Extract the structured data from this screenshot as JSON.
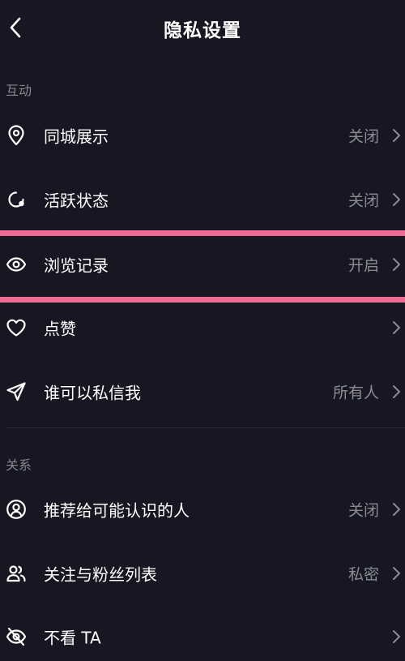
{
  "header": {
    "title": "隐私设置",
    "back_icon": "chevron-left-icon"
  },
  "sections": {
    "interaction": {
      "title": "互动",
      "items": [
        {
          "label": "同城展示",
          "value": "关闭",
          "icon": "location-pin-icon"
        },
        {
          "label": "活跃状态",
          "value": "关闭",
          "icon": "activity-status-icon"
        },
        {
          "label": "浏览记录",
          "value": "开启",
          "icon": "eye-icon"
        },
        {
          "label": "点赞",
          "value": "",
          "icon": "heart-icon"
        },
        {
          "label": "谁可以私信我",
          "value": "所有人",
          "icon": "send-icon"
        }
      ]
    },
    "relationship": {
      "title": "关系",
      "items": [
        {
          "label": "推荐给可能认识的人",
          "value": "关闭",
          "icon": "user-circle-icon"
        },
        {
          "label": "关注与粉丝列表",
          "value": "私密",
          "icon": "users-icon"
        },
        {
          "label": "不看 TA",
          "value": "",
          "icon": "eye-off-icon"
        }
      ]
    }
  },
  "colors": {
    "background": "#161722",
    "text_primary": "#ffffff",
    "text_secondary": "#8b8c93",
    "highlight": "#f06b94"
  }
}
